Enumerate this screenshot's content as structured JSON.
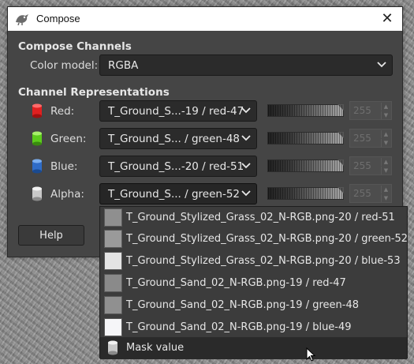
{
  "window": {
    "title": "Compose",
    "close_glyph": "✕",
    "app_icon": "gimp-wilber-icon"
  },
  "compose_channels": {
    "heading": "Compose Channels",
    "color_model_label": "Color model:",
    "color_model_value": "RGBA"
  },
  "channel_representations": {
    "heading": "Channel Representations",
    "channels": [
      {
        "label": "Red:",
        "value": "T_Ground_S...-19 / red-47",
        "spin_value": "255",
        "icon": "red-cylinder-icon",
        "color": "#e02020"
      },
      {
        "label": "Green:",
        "value": "T_Ground_S... / green-48",
        "spin_value": "255",
        "icon": "green-cylinder-icon",
        "color": "#5ccc1c"
      },
      {
        "label": "Blue:",
        "value": "T_Ground_S...-20 / red-51",
        "spin_value": "255",
        "icon": "blue-cylinder-icon",
        "color": "#2f6cc8"
      },
      {
        "label": "Alpha:",
        "value": "T_Ground_S... / green-52",
        "spin_value": "255",
        "icon": "gray-cylinder-icon",
        "color": "#c8c8c8"
      }
    ]
  },
  "buttons": {
    "help": "Help"
  },
  "dropdown": {
    "options": [
      {
        "label": "T_Ground_Stylized_Grass_02_N-RGB.png-20 / red-51",
        "thumb_color": "#8f8f8f"
      },
      {
        "label": "T_Ground_Stylized_Grass_02_N-RGB.png-20 / green-52",
        "thumb_color": "#9a9a9a"
      },
      {
        "label": "T_Ground_Stylized_Grass_02_N-RGB.png-20 / blue-53",
        "thumb_color": "#e4e4e4"
      },
      {
        "label": "T_Ground_Sand_02_N-RGB.png-19 / red-47",
        "thumb_color": "#8a8a8a"
      },
      {
        "label": "T_Ground_Sand_02_N-RGB.png-19 / green-48",
        "thumb_color": "#909090"
      },
      {
        "label": "T_Ground_Sand_02_N-RGB.png-19 / blue-49",
        "thumb_color": "#f6f6f8"
      },
      {
        "label": "Mask value",
        "icon": "gray-cylinder-icon"
      }
    ],
    "selected_index": 6
  },
  "colors": {
    "dialog_bg": "#454545",
    "combo_bg": "#2b2b2b",
    "text": "#e6e6e6"
  }
}
